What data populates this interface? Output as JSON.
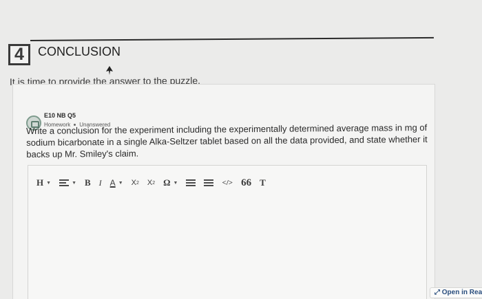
{
  "section": {
    "number": "4",
    "title": "CONCLUSION"
  },
  "intro": "It is time to provide the answer to the puzzle.",
  "question": {
    "id": "E10 NB Q5",
    "type": "Homework",
    "status": "Unanswered",
    "prompt": "Write a conclusion for the experiment including the experimentally determined average mass in mg of sodium bicarbonate in a single Alka-Seltzer tablet based on all the data provided, and state whether it backs up Mr. Smiley's claim."
  },
  "toolbar": {
    "heading": "H",
    "bold": "B",
    "italic": "I",
    "text_color": "A",
    "subscript_base": "X",
    "subscript_mark": "2",
    "superscript_base": "X",
    "superscript_mark": "2",
    "special_char": "Ω",
    "code": "</>",
    "quote": "66",
    "clear_format": "T"
  },
  "open_reader_label": "Open in Readi"
}
